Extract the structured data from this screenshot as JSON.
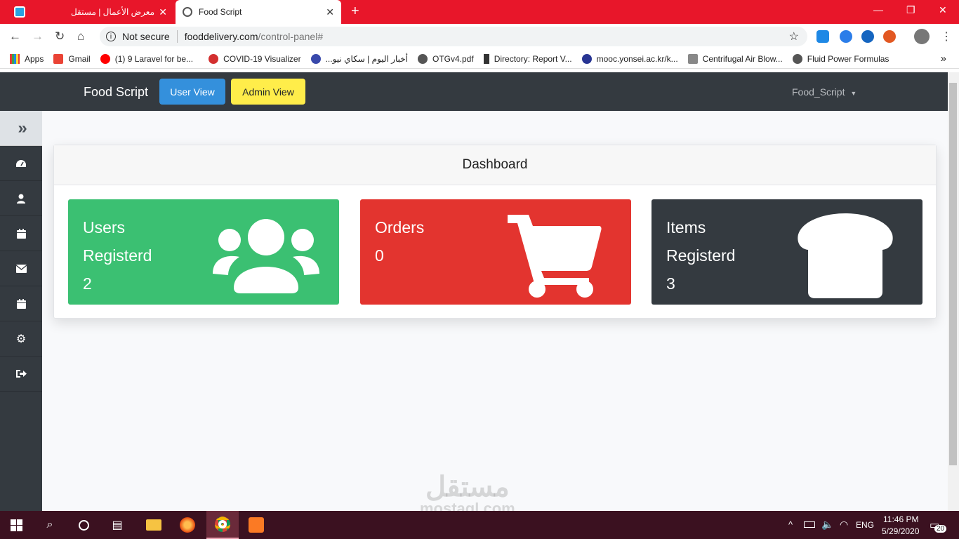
{
  "browser": {
    "tabs": [
      {
        "title": "معرض الأعمال | مستقل",
        "active": false
      },
      {
        "title": "Food Script",
        "active": true
      }
    ],
    "new_tab_symbol": "+",
    "security_label": "Not secure",
    "url_host": "fooddelivery.com",
    "url_path": "/control-panel#",
    "bookmarks": [
      "Apps",
      "Gmail",
      "(1) 9 Laravel for be...",
      "COVID-19 Visualizer",
      "أخبار اليوم | سكاي نيو...",
      "OTGv4.pdf",
      "Directory: Report V...",
      "mooc.yonsei.ac.kr/k...",
      "Centrifugal Air Blow...",
      "Fluid Power Formulas"
    ],
    "bookmarks_overflow": "»"
  },
  "navbar": {
    "brand": "Food Script",
    "user_view": "User View",
    "admin_view": "Admin View",
    "user_menu": "Food_Script"
  },
  "sidebar": {
    "items": [
      {
        "icon": "chevrons-right-icon"
      },
      {
        "icon": "dashboard-gauge-icon"
      },
      {
        "icon": "user-icon"
      },
      {
        "icon": "calendar-icon"
      },
      {
        "icon": "envelope-icon"
      },
      {
        "icon": "calendar-alt-icon"
      },
      {
        "icon": "gear-icon"
      },
      {
        "icon": "sign-out-icon"
      }
    ]
  },
  "dashboard": {
    "title": "Dashboard",
    "cards": [
      {
        "line1": "Users",
        "line2": "Registerd",
        "value": "2",
        "color": "#3bc072",
        "icon": "users-icon"
      },
      {
        "line1": "Orders",
        "line2": "",
        "value": "0",
        "color": "#e3342f",
        "icon": "cart-icon"
      },
      {
        "line1": "Items",
        "line2": "Registerd",
        "value": "3",
        "color": "#343a40",
        "icon": "bread-icon"
      }
    ]
  },
  "taskbar": {
    "lang": "ENG",
    "time": "11:46 PM",
    "date": "5/29/2020",
    "notifications": "20"
  },
  "watermark": {
    "arabic": "مستقل",
    "latin": "mostaql.com"
  },
  "colors": {
    "chrome_red": "#e8162a",
    "navbar": "#343a40",
    "user_view_btn": "#3490dc",
    "admin_view_btn": "#ffed4a"
  }
}
